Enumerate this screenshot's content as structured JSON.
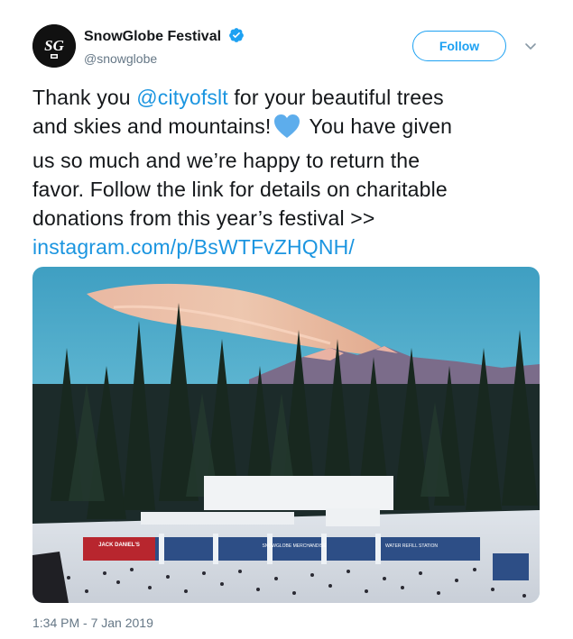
{
  "account": {
    "avatar_text": "SG",
    "display_name": "SnowGlobe Festival",
    "handle": "@snowglobe",
    "verified": true
  },
  "actions": {
    "follow_label": "Follow",
    "more_icon": "chevron-down-icon"
  },
  "tweet": {
    "line1_a": "Thank you ",
    "mention": "@cityofslt",
    "line1_b": " for your beautiful trees",
    "line2_a": "and skies and mountains!",
    "heart_icon": "blue-heart-emoji",
    "line2_b": " You have given",
    "line3": "us so much and we’re happy to return the",
    "line4": "favor. Follow the link for details on charitable",
    "line5": "donations from this year’s festival >>",
    "url": "instagram.com/p/BsWTFvZHQNH/"
  },
  "media": {
    "banner_left": "JACK DANIEL'S",
    "banner_mid": "SNOWGLOBE MERCHANDISE",
    "banner_right": "WATER REFILL STATION"
  },
  "timestamp": "1:34 PM - 7 Jan 2019",
  "colors": {
    "link": "#1b95e0",
    "follow": "#1da1f2",
    "secondary_text": "#657786"
  }
}
